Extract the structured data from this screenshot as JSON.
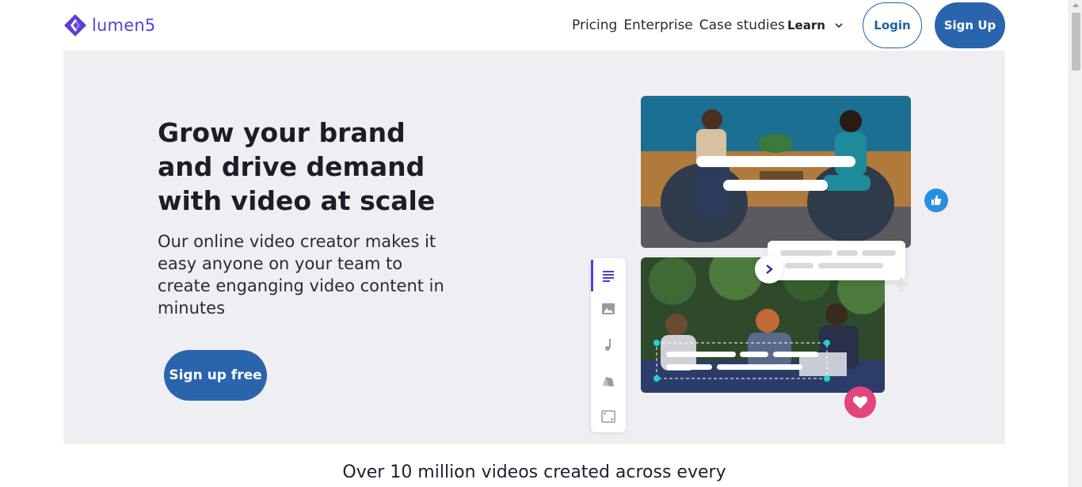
{
  "brand": {
    "name": "lumen5",
    "color": "#5b3fd9"
  },
  "nav": {
    "links": [
      "Pricing",
      "Enterprise",
      "Case studies"
    ],
    "learn_label": "Learn",
    "login_label": "Login",
    "signup_label": "Sign Up"
  },
  "hero": {
    "title": "Grow your brand and drive demand with video at scale",
    "subtitle": "Our online video creator makes it easy anyone on your team to create enganging video content in minutes",
    "cta_label": "Sign up free"
  },
  "illustration": {
    "toolbar_icons": [
      "text-icon",
      "image-icon",
      "music-icon",
      "style-icon",
      "format-icon"
    ],
    "active_tool": "text-icon"
  },
  "bottom": {
    "headline": "Over 10 million videos created across every"
  },
  "colors": {
    "primary": "#2a64ad",
    "hero_bg": "#efeff3",
    "like": "#2a8fe0",
    "heart": "#e2457a"
  }
}
